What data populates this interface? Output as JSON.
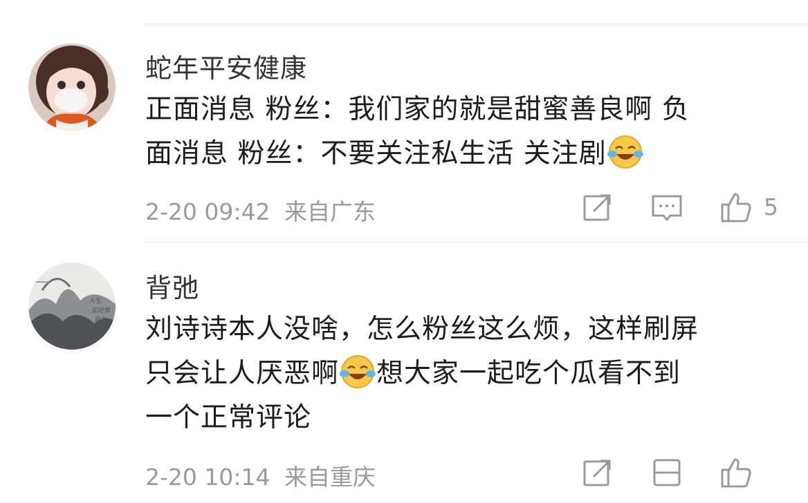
{
  "comments": [
    {
      "username": "蛇年平安健康",
      "text_line1": "正面消息 粉丝：我们家的就是甜蜜善良啊 负",
      "text_line2": "面消息 粉丝：不要关注私生活 关注剧",
      "emoji": "laugh-cry-emoji",
      "time": "2-20 09:42",
      "location": "来自广东",
      "like_count": "5",
      "avatar": "girl-with-mask-avatar"
    },
    {
      "username": "背弛",
      "text_line1": "刘诗诗本人没啥，怎么粉丝这么烦，这样刷屏",
      "text_line2a": "只会让人厌恶啊",
      "text_line2b": "想大家一起吃个瓜看不到",
      "text_line3": "一个正常评论",
      "emoji": "laugh-cry-emoji",
      "time": "2-20 10:14",
      "location": "来自重庆",
      "avatar": "landscape-painting-avatar"
    }
  ],
  "colors": {
    "text": "#1c1c1c",
    "meta": "#9a9a9a",
    "separator": "#e6e6e6",
    "emoji_yellow": "#f7c948"
  }
}
